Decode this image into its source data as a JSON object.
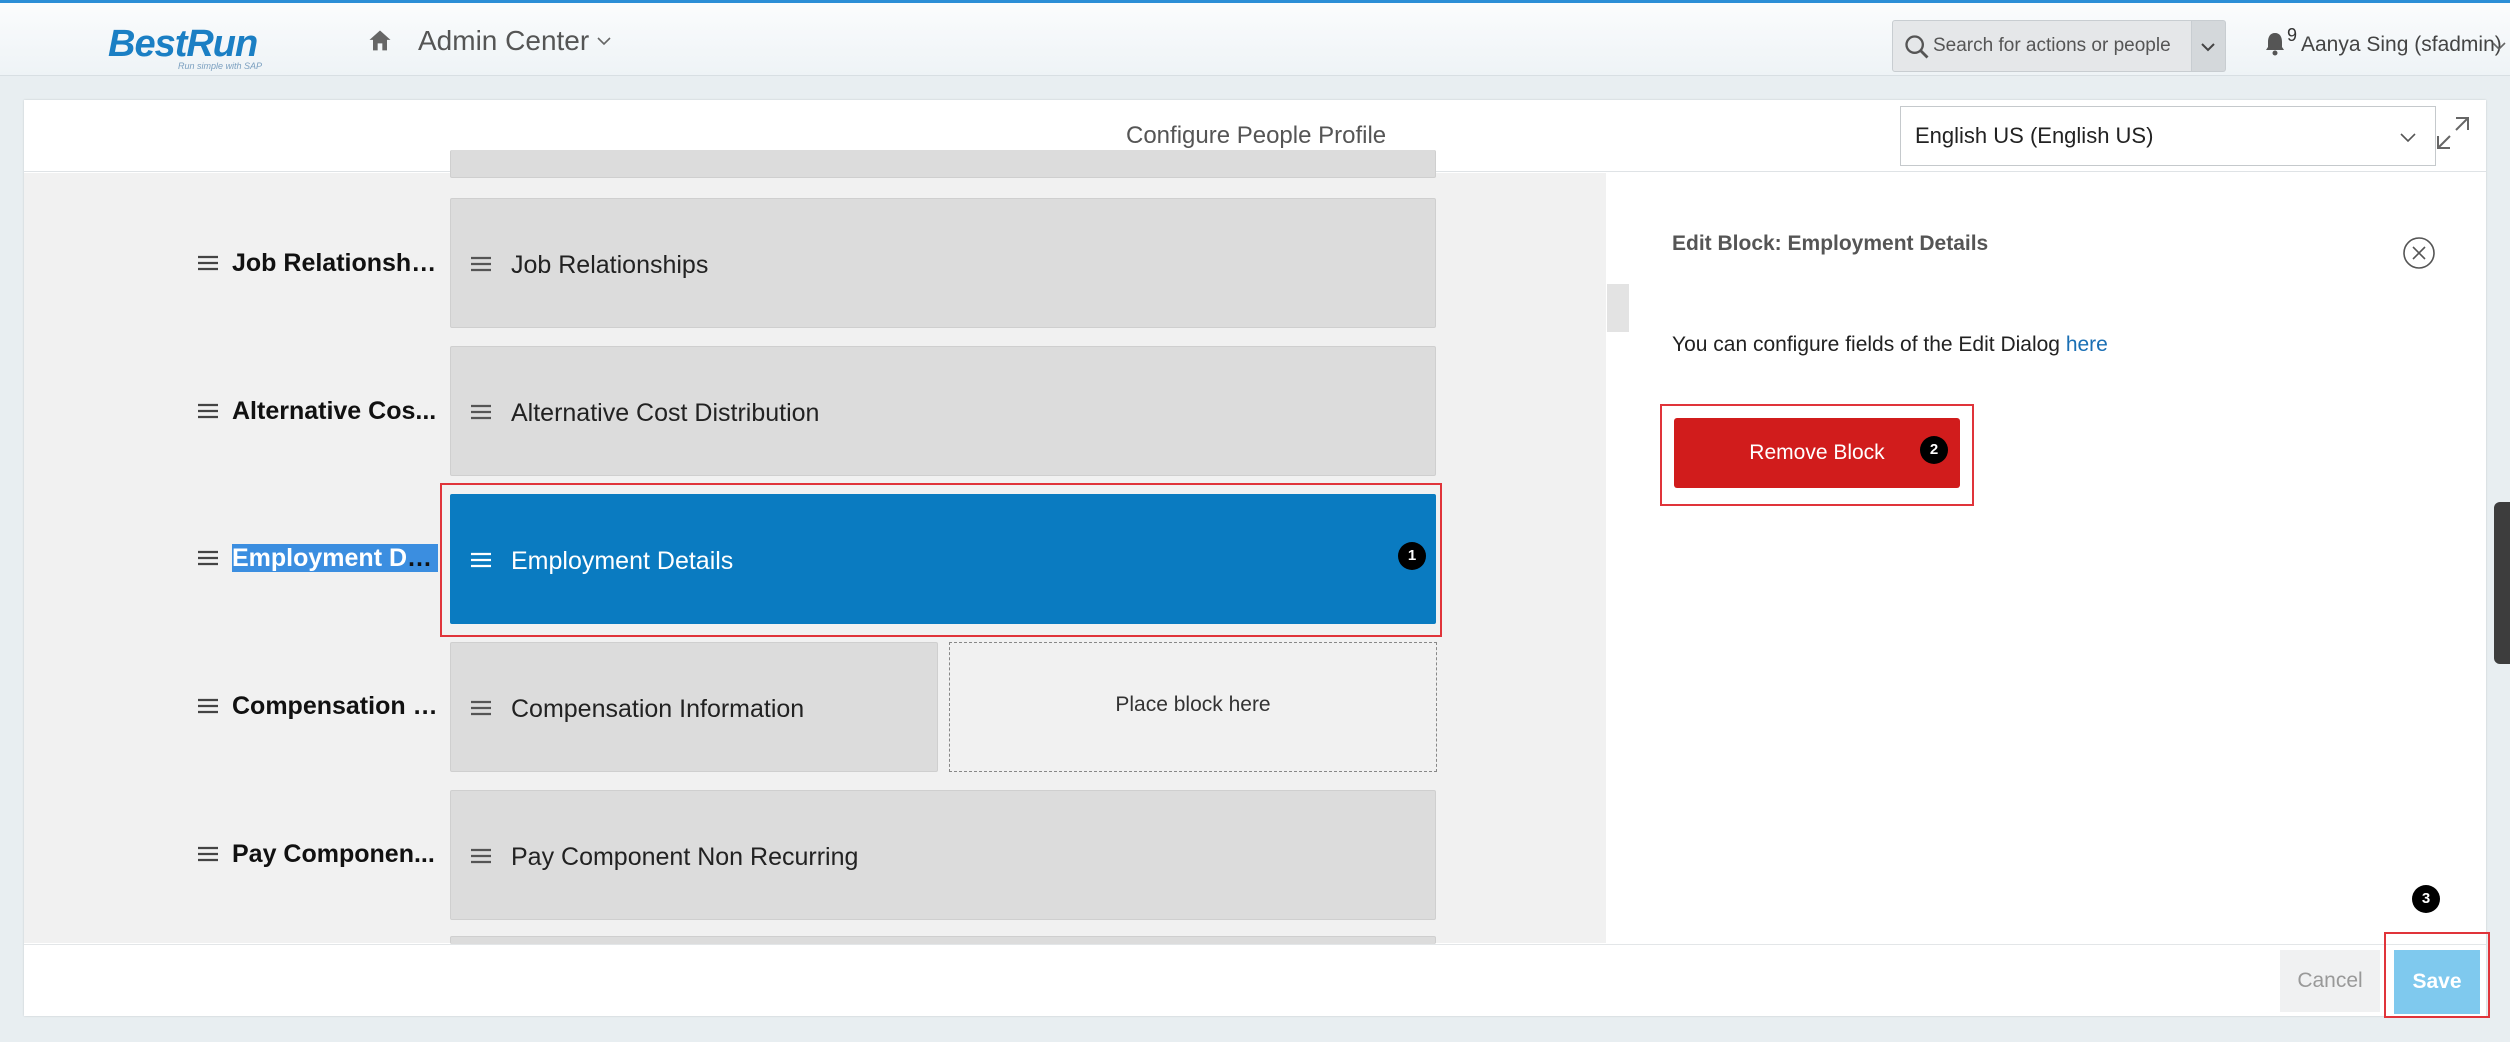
{
  "header": {
    "logo_text": "BestRun",
    "logo_tagline": "Run simple with SAP",
    "home_icon": "home-icon",
    "app_title": "Admin Center",
    "search_placeholder": "Search for actions or people",
    "notification_count": "9",
    "user": "Aanya Sing (sfadmin)"
  },
  "page": {
    "title": "Configure People Profile",
    "language": "English US (English US)"
  },
  "rows": [
    {
      "label": "Job Relationshi...",
      "block": "Job Relationships"
    },
    {
      "label": "Alternative Cos...",
      "block": "Alternative Cost Distribution"
    },
    {
      "label": "Employment De...",
      "block": "Employment Details"
    },
    {
      "label": "Compensation I...",
      "block": "Compensation Information",
      "placeholder": "Place block here"
    },
    {
      "label": "Pay Componen...",
      "block": "Pay Component Non Recurring"
    }
  ],
  "edit_panel": {
    "title": "Edit Block: Employment Details",
    "info_text": "You can configure fields of the Edit Dialog",
    "info_link": "here",
    "remove_label": "Remove Block"
  },
  "footer": {
    "cancel_label": "Cancel",
    "save_label": "Save"
  },
  "badges": [
    "1",
    "2",
    "3"
  ],
  "colors": {
    "accent": "#0a7bc1",
    "danger": "#d11c1c",
    "save": "#7fc9ee",
    "callout": "#e0343a"
  }
}
